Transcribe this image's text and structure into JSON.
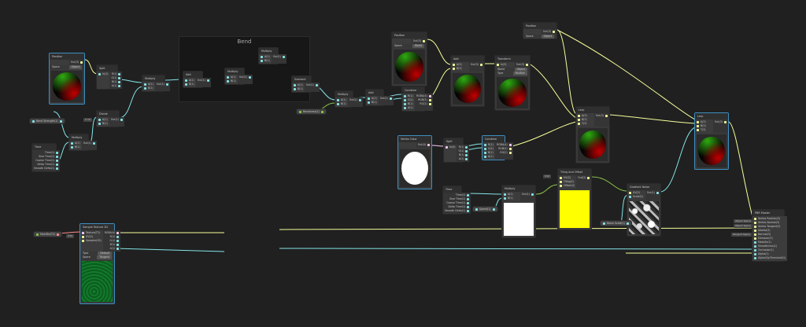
{
  "graph": {
    "group_title": "Bend",
    "colors": {
      "background": "#202020",
      "vector1": "#84e4e7",
      "vector3": "#f6ff9a",
      "vector4": "#fbcbf4",
      "texture": "#ff8b8b",
      "selection": "#3d8fc2"
    },
    "properties": [
      {
        "label": "Bend Strength(1)"
      },
      {
        "label": "Bendiness(1)"
      },
      {
        "label": "Speed(1)"
      },
      {
        "label": "Noise Scale(1)"
      },
      {
        "label": "MainTex(T2)"
      }
    ],
    "inlets": [
      {
        "label": "X 10"
      },
      {
        "label": "UV0"
      },
      {
        "label": "UV0"
      },
      {
        "label": "Object Space"
      },
      {
        "label": "Object Space"
      },
      {
        "label": "Tangent Space"
      }
    ],
    "nodes": [
      {
        "id": "pos1",
        "title": "Position",
        "inputs": [],
        "outputs": [
          "Out(3)"
        ],
        "controls": [
          [
            "Space",
            "Object"
          ]
        ],
        "preview": "sphere",
        "selected": true
      },
      {
        "id": "split1",
        "title": "Split",
        "inputs": [
          "In(1)"
        ],
        "outputs": [
          "R(1)",
          "G(1)",
          "B(1)",
          "A(1)"
        ]
      },
      {
        "id": "mul1",
        "title": "Multiply",
        "inputs": [
          "A(1)",
          "B(1)"
        ],
        "outputs": [
          "Out(1)"
        ]
      },
      {
        "id": "div1",
        "title": "Divide",
        "inputs": [
          "A(1)",
          "B(1)"
        ],
        "outputs": [
          "Out(1)"
        ]
      },
      {
        "id": "mul2",
        "title": "Multiply",
        "inputs": [
          "A(1)",
          "B(1)"
        ],
        "outputs": [
          "Out(1)"
        ]
      },
      {
        "id": "time1",
        "title": "Time",
        "inputs": [],
        "outputs": [
          "Time(1)",
          "Sine Time(1)",
          "Cosine Time(1)",
          "Delta Time(1)",
          "Smooth Delta(1)"
        ]
      },
      {
        "id": "add1",
        "title": "Add",
        "inputs": [
          "A(1)",
          "B(1)"
        ],
        "outputs": [
          "Out(1)"
        ]
      },
      {
        "id": "mul3",
        "title": "Multiply",
        "inputs": [
          "A(1)",
          "B(1)"
        ],
        "outputs": [
          "Out(1)"
        ]
      },
      {
        "id": "mul4",
        "title": "Multiply",
        "inputs": [
          "A(1)",
          "B(1)"
        ],
        "outputs": [
          "Out(1)"
        ]
      },
      {
        "id": "sub1",
        "title": "Subtract",
        "inputs": [
          "A(1)",
          "B(1)"
        ],
        "outputs": [
          "Out(1)"
        ]
      },
      {
        "id": "mul5",
        "title": "Multiply",
        "inputs": [
          "A(1)",
          "B(1)"
        ],
        "outputs": [
          "Out(1)"
        ]
      },
      {
        "id": "add2",
        "title": "Add",
        "inputs": [
          "A(1)",
          "B(1)"
        ],
        "outputs": [
          "Out(1)"
        ]
      },
      {
        "id": "comb1",
        "title": "Combine",
        "inputs": [
          "R(1)",
          "G(1)",
          "B(1)",
          "A(1)"
        ],
        "outputs": [
          "RGBA(4)",
          "RGB(3)",
          "RG(2)"
        ]
      },
      {
        "id": "pos2",
        "title": "Position",
        "inputs": [],
        "outputs": [
          "Out(3)"
        ],
        "controls": [
          [
            "Space",
            "World"
          ]
        ],
        "preview": "sphere"
      },
      {
        "id": "add3",
        "title": "Add",
        "inputs": [
          "A(3)",
          "B(3)"
        ],
        "outputs": [
          "Out(3)"
        ],
        "preview": "sphere"
      },
      {
        "id": "xf1",
        "title": "Transform",
        "inputs": [
          "In(3)"
        ],
        "outputs": [
          "Out(3)"
        ],
        "controls": [
          [
            "World",
            "Object"
          ],
          [
            "Type",
            "Position"
          ]
        ],
        "preview": "sphere"
      },
      {
        "id": "pos3",
        "title": "Position",
        "inputs": [],
        "outputs": [
          "Out(3)"
        ],
        "controls": [
          [
            "Space",
            "Object"
          ]
        ]
      },
      {
        "id": "lerp1",
        "title": "Lerp",
        "inputs": [
          "A(3)",
          "B(3)",
          "T(3)"
        ],
        "outputs": [
          "Out(3)"
        ],
        "preview": "sphere"
      },
      {
        "id": "lerp2",
        "title": "Lerp",
        "inputs": [
          "A(3)",
          "B(3)",
          "T(3)"
        ],
        "outputs": [
          "Out(3)"
        ],
        "preview": "sphere",
        "selected": true
      },
      {
        "id": "vcol",
        "title": "Vertex Color",
        "inputs": [],
        "outputs": [
          "Out(4)"
        ],
        "preview": "circle",
        "selected": true
      },
      {
        "id": "split2",
        "title": "Split",
        "inputs": [
          "In(4)"
        ],
        "outputs": [
          "R(1)",
          "G(1)",
          "B(1)",
          "A(1)"
        ]
      },
      {
        "id": "comb2",
        "title": "Combine",
        "inputs": [
          "R(1)",
          "G(1)",
          "B(1)",
          "A(1)"
        ],
        "outputs": [
          "RGBA(4)",
          "RGB(3)",
          "RG(2)"
        ],
        "selected": true
      },
      {
        "id": "time2",
        "title": "Time",
        "inputs": [],
        "outputs": [
          "Time(1)",
          "Sine Time(1)",
          "Cosine Time(1)",
          "Delta Time(1)",
          "Smooth Delta(1)"
        ]
      },
      {
        "id": "mul6",
        "title": "Multiply",
        "inputs": [
          "A(1)",
          "B(1)"
        ],
        "outputs": [
          "Out(1)"
        ],
        "preview": "white"
      },
      {
        "id": "tao",
        "title": "Tiling And Offset",
        "inputs": [
          "UV(2)",
          "Tiling(2)",
          "Offset(2)"
        ],
        "outputs": [
          "Out(2)"
        ],
        "preview": "yellow"
      },
      {
        "id": "gnoise",
        "title": "Gradient Noise",
        "inputs": [
          "UV(2)",
          "Scale(1)"
        ],
        "outputs": [
          "Out(1)"
        ],
        "preview": "noise"
      },
      {
        "id": "pbr",
        "title": "PBR Master",
        "inputs": [
          "Vertex Position(3)",
          "Vertex Normal(3)",
          "Vertex Tangent(3)",
          "Albedo(3)",
          "Normal(3)",
          "Emission(3)",
          "Metallic(1)",
          "Smoothness(1)",
          "Occlusion(1)",
          "Alpha(1)",
          "AlphaClipThreshold(1)"
        ],
        "outputs": []
      },
      {
        "id": "tex",
        "title": "Sample Texture 2D",
        "inputs": [
          "Texture(T2)",
          "UV(2)",
          "Sampler(SS)"
        ],
        "outputs": [
          "RGBA(4)",
          "R(1)",
          "G(1)",
          "B(1)",
          "A(1)"
        ],
        "controls": [
          [
            "Type",
            "Default"
          ],
          [
            "Space",
            "Tangent"
          ]
        ],
        "preview": "tex",
        "selected": true
      }
    ]
  }
}
